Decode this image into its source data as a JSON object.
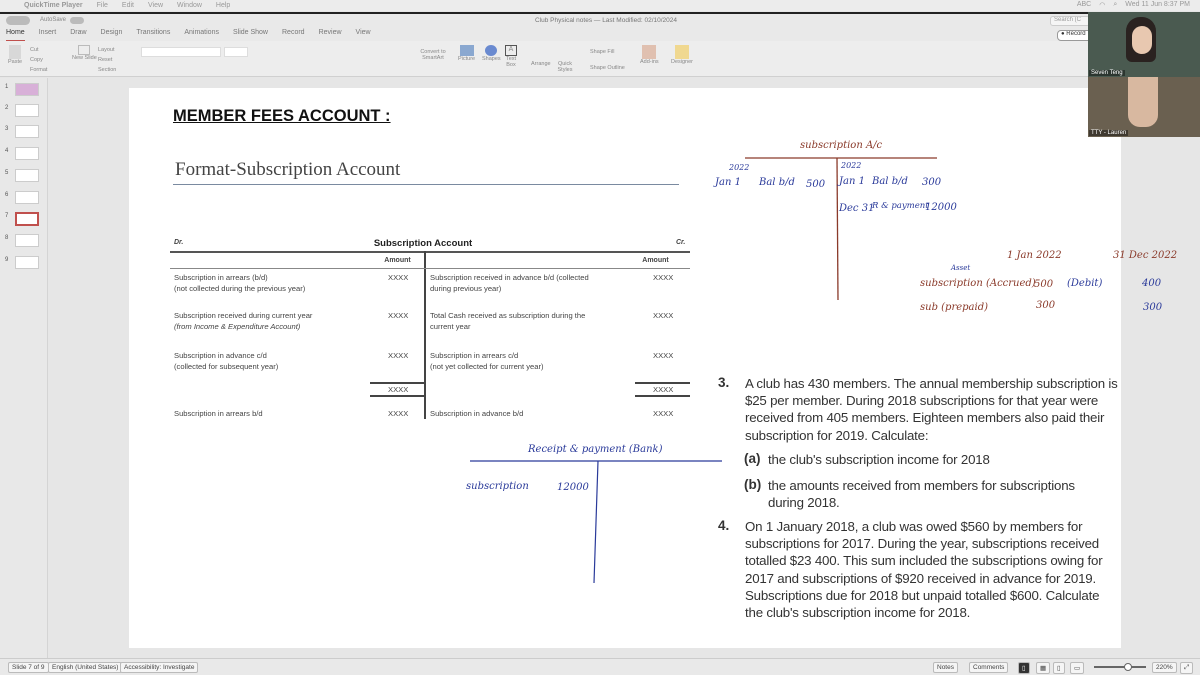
{
  "menubar": {
    "app": "QuickTime Player",
    "items": [
      "File",
      "Edit",
      "View",
      "Window",
      "Help"
    ],
    "clock": "Wed 11 Jun  8:37 PM",
    "input": "ABC"
  },
  "window": {
    "autosave": "AutoSave",
    "doc_title": "Club Physical notes — Last Modified: 02/10/2024",
    "search_placeholder": "Search (C",
    "record": "Record"
  },
  "tabs": [
    "Home",
    "Insert",
    "Draw",
    "Design",
    "Transitions",
    "Animations",
    "Slide Show",
    "Record",
    "Review",
    "View"
  ],
  "ribbon": {
    "paste": "Paste",
    "cut": "Cut",
    "copy": "Copy",
    "format": "Format",
    "new_slide": "New Slide",
    "layout": "Layout",
    "reset": "Reset",
    "section": "Section",
    "convert": "Convert to SmartArt",
    "picture": "Picture",
    "shapes": "Shapes",
    "text_box": "Text Box",
    "arrange": "Arrange",
    "quick_styles": "Quick Styles",
    "shape_fill": "Shape Fill",
    "shape_outline": "Shape Outline",
    "addins": "Add-ins",
    "designer": "Designer"
  },
  "thumbnails": [
    "1",
    "2",
    "3",
    "4",
    "5",
    "6",
    "7",
    "8",
    "9"
  ],
  "slide": {
    "heading": "MEMBER FEES ACCOUNT :",
    "subtitle": "Format-Subscription Account",
    "table": {
      "dr": "Dr.",
      "cr": "Cr.",
      "title": "Subscription Account",
      "amount": "Amount",
      "left": [
        [
          "Subscription in arrears (b/d)",
          "(not collected during the previous year)"
        ],
        [
          "Subscription received during current year ",
          "(from Income & Expenditure Account)"
        ],
        [
          "Subscription in advance c/d",
          "(collected for subsequent year)"
        ]
      ],
      "right": [
        [
          "Subscription received in advance b/d (collected",
          "during previous year)"
        ],
        [
          "Total Cash received as subscription during the",
          "current year"
        ],
        [
          "Subscription in arrears c/d",
          "(not yet collected for current year)"
        ]
      ],
      "value": "XXXX",
      "left_final": "Subscription in arrears b/d",
      "right_final": "Subscription in advance b/d"
    },
    "handwriting": {
      "sub_title": "subscription A/c",
      "y1": "2022",
      "y2": "2022",
      "jan1": "Jan 1",
      "bal_bd": "Bal b/d",
      "v500": "500",
      "jan1b": "Jan 1",
      "bal_bd2": "Bal b/d",
      "v300": "300",
      "dec31": "Dec 31",
      "rp": "R & payment",
      "v12000": "12000",
      "date1": "1 Jan 2022",
      "date2": "31 Dec 2022",
      "asset": "Asset",
      "row1": "subscription (Accrued)",
      "r1v1": "500",
      "debit": "(Debit)",
      "r1v2": "400",
      "row2": "sub (prepaid)",
      "r2v1": "300",
      "r2v2": "300",
      "rp_title": "Receipt & payment (Bank)",
      "rp_sub": "subscription",
      "rp_val": "12000"
    },
    "q3": {
      "num": "3.",
      "text": "A club has 430 members. The annual membership subscription is $25 per member. During 2018 subscriptions for that year were received from 405 members. Eighteen members also paid their subscription for 2019. Calculate:",
      "a_label": "(a)",
      "a": "the club's subscription income for 2018",
      "b_label": "(b)",
      "b": "the amounts received from members for subscriptions during 2018."
    },
    "q4": {
      "num": "4.",
      "text": "On 1 January 2018, a club was owed $560 by members for subscriptions for 2017. During the year, subscriptions received totalled $23 400. This sum included the subscriptions owing for 2017 and subscriptions of $920 received in advance for 2019. Subscriptions due for 2018 but unpaid totalled $600. Calculate the club's subscription income for 2018."
    }
  },
  "status": {
    "slide": "Slide 7 of 9",
    "lang": "English (United States)",
    "access": "Accessibility: Investigate",
    "notes": "Notes",
    "comments": "Comments",
    "zoom": "220%"
  },
  "video": {
    "p1": "Seven Teng",
    "p2": "TTY - Lauren"
  }
}
